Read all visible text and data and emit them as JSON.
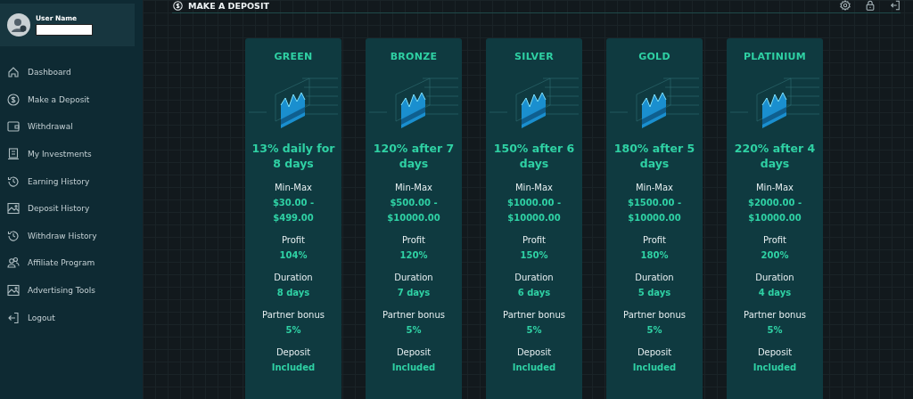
{
  "user": {
    "label": "User Name"
  },
  "sidebar": {
    "items": [
      {
        "label": "Dashboard"
      },
      {
        "label": "Make a Deposit"
      },
      {
        "label": "Withdrawal"
      },
      {
        "label": "My Investments"
      },
      {
        "label": "Earning History"
      },
      {
        "label": "Deposit History"
      },
      {
        "label": "Withdraw History"
      },
      {
        "label": "Affiliate Program"
      },
      {
        "label": "Advertising Tools"
      },
      {
        "label": "Logout"
      }
    ]
  },
  "header": {
    "title": "MAKE A DEPOSIT"
  },
  "plans": [
    {
      "name": "GREEN",
      "headline": "13% daily for 8 days",
      "rows": [
        {
          "label": "Min-Max",
          "value": "$30.00 - $499.00"
        },
        {
          "label": "Profit",
          "value": "104%"
        },
        {
          "label": "Duration",
          "value": "8 days"
        },
        {
          "label": "Partner bonus",
          "value": "5%"
        },
        {
          "label": "Deposit",
          "value": "Included"
        }
      ]
    },
    {
      "name": "BRONZE",
      "headline": "120% after 7 days",
      "rows": [
        {
          "label": "Min-Max",
          "value": "$500.00 - $10000.00"
        },
        {
          "label": "Profit",
          "value": "120%"
        },
        {
          "label": "Duration",
          "value": "7 days"
        },
        {
          "label": "Partner bonus",
          "value": "5%"
        },
        {
          "label": "Deposit",
          "value": "Included"
        }
      ]
    },
    {
      "name": "SILVER",
      "headline": "150% after 6 days",
      "rows": [
        {
          "label": "Min-Max",
          "value": "$1000.00 - $10000.00"
        },
        {
          "label": "Profit",
          "value": "150%"
        },
        {
          "label": "Duration",
          "value": "6 days"
        },
        {
          "label": "Partner bonus",
          "value": "5%"
        },
        {
          "label": "Deposit",
          "value": "Included"
        }
      ]
    },
    {
      "name": "GOLD",
      "headline": "180% after 5 days",
      "rows": [
        {
          "label": "Min-Max",
          "value": "$1500.00 - $10000.00"
        },
        {
          "label": "Profit",
          "value": "180%"
        },
        {
          "label": "Duration",
          "value": "5 days"
        },
        {
          "label": "Partner bonus",
          "value": "5%"
        },
        {
          "label": "Deposit",
          "value": "Included"
        }
      ]
    },
    {
      "name": "PLATINIUM",
      "headline": "220% after 4 days",
      "rows": [
        {
          "label": "Min-Max",
          "value": "$2000.00 - $10000.00"
        },
        {
          "label": "Profit",
          "value": "200%"
        },
        {
          "label": "Duration",
          "value": "4 days"
        },
        {
          "label": "Partner bonus",
          "value": "5%"
        },
        {
          "label": "Deposit",
          "value": "Included"
        }
      ]
    }
  ]
}
